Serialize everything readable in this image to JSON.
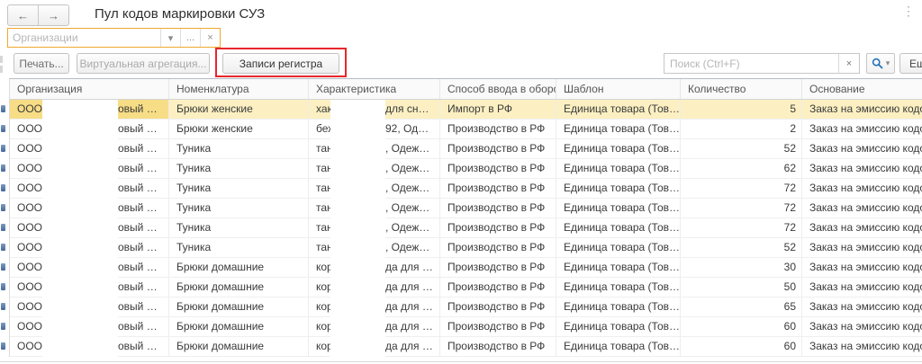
{
  "window": {
    "title": "Пул кодов маркировки СУЗ",
    "menu_icon": "⋮"
  },
  "nav": {
    "back_icon": "←",
    "forward_icon": "→"
  },
  "filter_field": {
    "placeholder": "Организации",
    "dropdown_icon": "▾",
    "choose_label": "...",
    "clear_icon": "×"
  },
  "toolbar": {
    "print_label": "Печать...",
    "virtual_aggregation_label": "Виртуальная агрегация...",
    "register_records_label": "Записи регистра",
    "more_label": "Ещ",
    "search": {
      "placeholder": "Поиск (Ctrl+F)",
      "clear_icon": "×",
      "dropdown_icon": "▾",
      "icon": "magnifier"
    }
  },
  "annotation": {
    "highlight_color": "#e8262d"
  },
  "colors": {
    "selected_row": "#fcf0c2",
    "selected_cell": "#f7dd86",
    "filter_focus_border": "#f0a72e"
  },
  "table": {
    "columns": [
      "Организация",
      "Номенклатура",
      "Характеристика",
      "Способ ввода в оборот",
      "Шаблон",
      "Количество",
      "Основание"
    ],
    "rows": [
      {
        "selected": true,
        "org_left": "ООО \"С",
        "org_right": "овый …",
        "nomenclature": "Брюки женские",
        "char_left": "хаки,",
        "char_right": "для сн…",
        "method": "Импорт в РФ",
        "template": "Единица товара (Тов…",
        "qty": "5",
        "basis": "Заказ на эмиссию кодов"
      },
      {
        "org_left": "ООО \"С",
        "org_right": "овый …",
        "nomenclature": "Брюки женские",
        "char_left": "беже",
        "char_right": "92, Од…",
        "method": "Производство в РФ",
        "template": "Единица товара (Тов…",
        "qty": "2",
        "basis": "Заказ на эмиссию кодов"
      },
      {
        "org_left": "ООО \"С",
        "org_right": "овый …",
        "nomenclature": "Туника",
        "char_left": "тане",
        "char_right": ", Одеж…",
        "method": "Производство в РФ",
        "template": "Единица товара (Тов…",
        "qty": "52",
        "basis": "Заказ на эмиссию кодов"
      },
      {
        "org_left": "ООО \"С",
        "org_right": "овый …",
        "nomenclature": "Туника",
        "char_left": "тане",
        "char_right": ", Одеж…",
        "method": "Производство в РФ",
        "template": "Единица товара (Тов…",
        "qty": "62",
        "basis": "Заказ на эмиссию кодов"
      },
      {
        "org_left": "ООО \"С",
        "org_right": "овый …",
        "nomenclature": "Туника",
        "char_left": "тане",
        "char_right": ", Одеж…",
        "method": "Производство в РФ",
        "template": "Единица товара (Тов…",
        "qty": "72",
        "basis": "Заказ на эмиссию кодов"
      },
      {
        "org_left": "ООО \"С",
        "org_right": "овый …",
        "nomenclature": "Туника",
        "char_left": "тане",
        "char_right": ", Одеж…",
        "method": "Производство в РФ",
        "template": "Единица товара (Тов…",
        "qty": "72",
        "basis": "Заказ на эмиссию кодов"
      },
      {
        "org_left": "ООО \"С",
        "org_right": "овый …",
        "nomenclature": "Туника",
        "char_left": "тане",
        "char_right": ", Одеж…",
        "method": "Производство в РФ",
        "template": "Единица товара (Тов…",
        "qty": "72",
        "basis": "Заказ на эмиссию кодов"
      },
      {
        "org_left": "ООО \"С",
        "org_right": "овый …",
        "nomenclature": "Туника",
        "char_left": "тане",
        "char_right": ", Одеж…",
        "method": "Производство в РФ",
        "template": "Единица товара (Тов…",
        "qty": "52",
        "basis": "Заказ на эмиссию кодов"
      },
      {
        "org_left": "ООО \"С",
        "org_right": "овый …",
        "nomenclature": "Брюки домашние",
        "char_left": "корал",
        "char_right": "да для …",
        "method": "Производство в РФ",
        "template": "Единица товара (Тов…",
        "qty": "30",
        "basis": "Заказ на эмиссию кодов"
      },
      {
        "org_left": "ООО \"С",
        "org_right": "овый …",
        "nomenclature": "Брюки домашние",
        "char_left": "корал",
        "char_right": "да для …",
        "method": "Производство в РФ",
        "template": "Единица товара (Тов…",
        "qty": "50",
        "basis": "Заказ на эмиссию кодов"
      },
      {
        "org_left": "ООО \"С",
        "org_right": "овый …",
        "nomenclature": "Брюки домашние",
        "char_left": "корал",
        "char_right": "да для …",
        "method": "Производство в РФ",
        "template": "Единица товара (Тов…",
        "qty": "65",
        "basis": "Заказ на эмиссию кодов"
      },
      {
        "org_left": "ООО \"С",
        "org_right": "овый …",
        "nomenclature": "Брюки домашние",
        "char_left": "корал",
        "char_right": "да для …",
        "method": "Производство в РФ",
        "template": "Единица товара (Тов…",
        "qty": "60",
        "basis": "Заказ на эмиссию кодов"
      },
      {
        "org_left": "ООО \"С",
        "org_right": "овый …",
        "nomenclature": "Брюки домашние",
        "char_left": "корал",
        "char_right": "да для …",
        "method": "Производство в РФ",
        "template": "Единица товара (Тов…",
        "qty": "60",
        "basis": "Заказ на эмиссию кодов"
      }
    ]
  }
}
